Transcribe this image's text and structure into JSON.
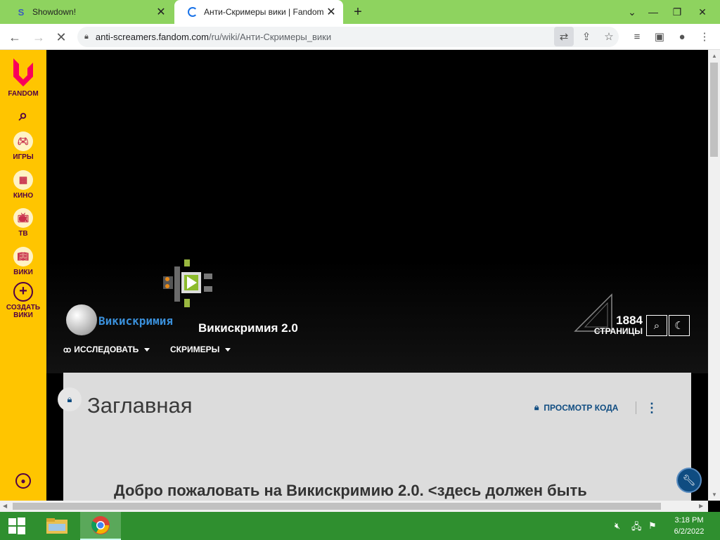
{
  "browser": {
    "tabs": [
      {
        "title": "Showdown!",
        "favicon": "S"
      },
      {
        "title": "Анти-Скримеры вики | Fandom",
        "favicon": "loading-spinner"
      }
    ],
    "url_host": "anti-screamers.fandom.com",
    "url_path": "/ru/wiki/Анти-Скримеры_вики"
  },
  "fandom_sidebar": {
    "brand": "FANDOM",
    "items": [
      {
        "label": "ИГРЫ",
        "icon": "gamepad-icon"
      },
      {
        "label": "КИНО",
        "icon": "film-icon"
      },
      {
        "label": "ТВ",
        "icon": "tv-icon"
      },
      {
        "label": "ВИКИ",
        "icon": "book-icon"
      }
    ],
    "create_label_1": "СОЗДАТЬ",
    "create_label_2": "ВИКИ"
  },
  "wiki_header": {
    "logo_text": "Викискримия",
    "name": "Викискримия 2.0",
    "pages_count": "1884",
    "pages_label": "СТРАНИЦЫ",
    "nav": [
      {
        "label": "ИССЛЕДОВАТЬ"
      },
      {
        "label": "СКРИМЕРЫ"
      }
    ]
  },
  "page": {
    "title": "Заглавная",
    "view_source_label": "ПРОСМОТР КОДА",
    "welcome_text": "Добро пожаловать на Викискримию 2.0. <здесь должен быть"
  },
  "taskbar": {
    "time": "3:18 PM",
    "date": "6/2/2022"
  },
  "colors": {
    "fandom_yellow": "#ffc500",
    "fandom_link": "#0f4c81",
    "chrome_tabstrip": "#8ed35f",
    "taskbar": "#2f8f2f"
  }
}
